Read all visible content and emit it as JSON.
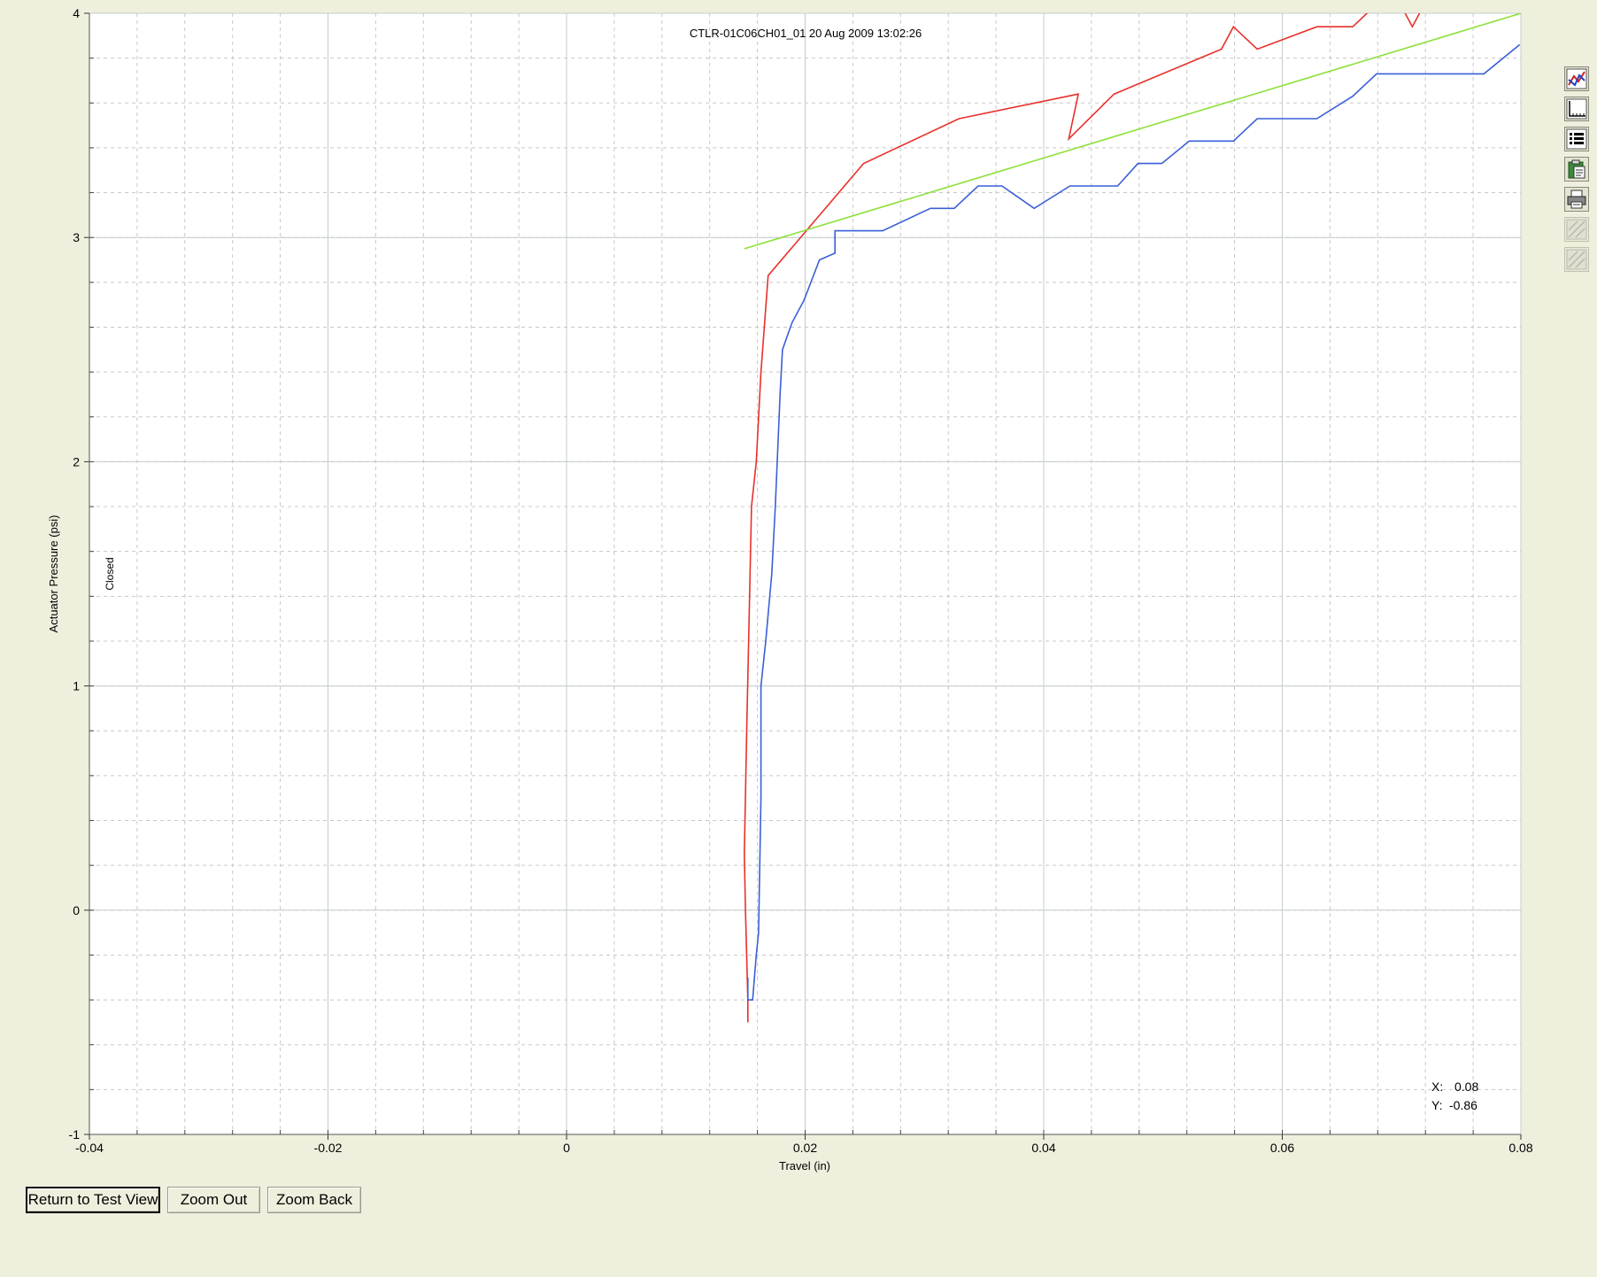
{
  "chart_data": {
    "type": "line",
    "title": "CTLR-01C06CH01_01 20 Aug 2009 13:02:26",
    "xlabel": "Travel (in)",
    "ylabel": "Actuator Pressure (psi)",
    "side_label": "Closed",
    "xlim": [
      -0.04,
      0.08
    ],
    "ylim": [
      -1,
      4
    ],
    "x_ticks": [
      -0.04,
      -0.02,
      0,
      0.02,
      0.04,
      0.06,
      0.08
    ],
    "x_tick_labels": [
      "-0.04",
      "-0.02",
      "0",
      "0.02",
      "0.04",
      "0.06",
      "0.08"
    ],
    "y_ticks": [
      -1,
      0,
      1,
      2,
      3,
      4
    ],
    "y_tick_labels": [
      "-1",
      "0",
      "1",
      "2",
      "3",
      "4"
    ],
    "x_minor_step": 0.004,
    "y_minor_step": 0.2,
    "grid": true,
    "series": [
      {
        "color": "#e8302a",
        "x": [
          0.0152,
          0.0152,
          0.015,
          0.0149,
          0.0151,
          0.0153,
          0.0155,
          0.0159,
          0.0163,
          0.0169,
          0.0249,
          0.0329,
          0.0429,
          0.0421,
          0.0459,
          0.0549,
          0.0559,
          0.0579,
          0.0629,
          0.0659,
          0.0679,
          0.0699,
          0.0709,
          0.0719
        ],
        "y": [
          -0.5,
          -0.4,
          0.0,
          0.25,
          0.8,
          1.3,
          1.8,
          2.0,
          2.4,
          2.83,
          3.33,
          3.53,
          3.64,
          3.44,
          3.64,
          3.84,
          3.94,
          3.84,
          3.94,
          3.94,
          4.04,
          4.04,
          3.94,
          4.04
        ]
      },
      {
        "color": "#3a5fd8",
        "x": [
          0.0152,
          0.0152,
          0.0156,
          0.0159,
          0.0161,
          0.0163,
          0.0163,
          0.0167,
          0.0172,
          0.0175,
          0.0179,
          0.0181,
          0.0189,
          0.0199,
          0.0212,
          0.0225,
          0.0225,
          0.0265,
          0.0305,
          0.0325,
          0.0345,
          0.0365,
          0.0392,
          0.0422,
          0.0462,
          0.0479,
          0.0499,
          0.0522,
          0.0559,
          0.0579,
          0.0629,
          0.0659,
          0.0679,
          0.0769,
          0.0799
        ],
        "y": [
          -0.3,
          -0.4,
          -0.4,
          -0.2,
          -0.1,
          0.5,
          1.0,
          1.2,
          1.5,
          1.8,
          2.3,
          2.5,
          2.62,
          2.72,
          2.9,
          2.93,
          3.03,
          3.03,
          3.13,
          3.13,
          3.23,
          3.23,
          3.13,
          3.23,
          3.23,
          3.33,
          3.33,
          3.43,
          3.43,
          3.53,
          3.53,
          3.63,
          3.73,
          3.73,
          3.86
        ]
      },
      {
        "color": "#8ee03a",
        "x": [
          0.0149,
          0.08
        ],
        "y": [
          2.95,
          4.0
        ]
      }
    ]
  },
  "cursor_readout": {
    "x_label": "X:",
    "x_value": "0.08",
    "y_label": "Y:",
    "y_value": "-0.86"
  },
  "buttons": {
    "return_label": "Return to Test View",
    "zoom_out_label": "Zoom Out",
    "zoom_back_label": "Zoom Back"
  },
  "toolbar": {
    "tools": [
      {
        "icon": "graph-lines-icon",
        "enabled": true
      },
      {
        "icon": "axes-icon",
        "enabled": true
      },
      {
        "icon": "list-icon",
        "enabled": true
      },
      {
        "icon": "clipboard-icon",
        "enabled": true
      },
      {
        "icon": "printer-icon",
        "enabled": true
      },
      {
        "icon": "hatch-icon",
        "enabled": false
      },
      {
        "icon": "sh-icon",
        "enabled": false
      }
    ]
  }
}
